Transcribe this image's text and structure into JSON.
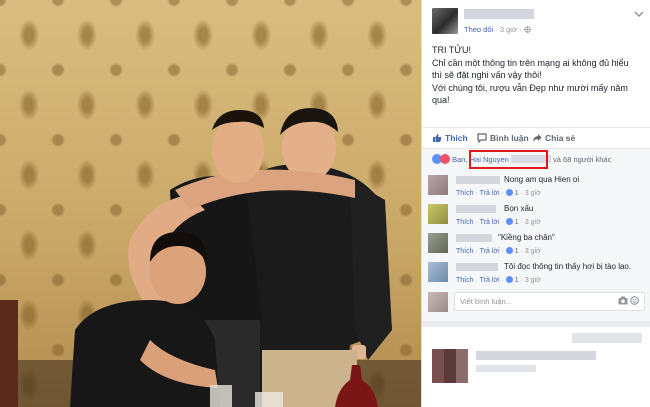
{
  "post": {
    "meta_follow": "Theo dõi",
    "meta_time": "· 3 giờ ·",
    "lines": [
      "TRI TỬU!",
      "Chỉ cần một thông tin trên mạng ai không đủ hiểu",
      "thì sẽ đặt nghi vấn vậy thôi!",
      "Với chúng tôi, rượu vẫn Đẹp như mười mấy năm",
      "qua!"
    ]
  },
  "actions": {
    "like": "Thích",
    "comment": "Bình luận",
    "share": "Chia sẻ"
  },
  "reactions": {
    "prefix": "Bạn,",
    "name": "Hai Nguyen",
    "suffix": "và 68 người khác"
  },
  "comments": [
    {
      "text": "Nong am qua Hien oi",
      "like": "Thích",
      "reply": "Trả lời",
      "count": "1",
      "time": "· 3 giờ"
    },
    {
      "text": "Bọn xấu",
      "like": "Thích",
      "reply": "Trả lời",
      "count": "1",
      "time": "· 3 giờ"
    },
    {
      "text": "\"Kiềng ba chân\"",
      "like": "Thích",
      "reply": "Trả lời",
      "count": "1",
      "time": "· 3 giờ"
    },
    {
      "text": "Tôi đọc thông tin thấy hơi bị tào lao.",
      "like": "Thích",
      "reply": "Trả lời",
      "count": "1",
      "time": "· 3 giờ"
    }
  ],
  "write_placeholder": "Viết bình luận...",
  "colors": {
    "accent": "#4267b2",
    "highlight_box": "#e0191f",
    "wallpaper": "#c7a568"
  },
  "icons": {
    "like": "thumbs-up-icon",
    "comment": "speech-bubble-icon",
    "share": "share-arrow-icon",
    "camera": "camera-icon",
    "sticker": "smiley-icon",
    "chevron": "chevron-down-icon"
  }
}
